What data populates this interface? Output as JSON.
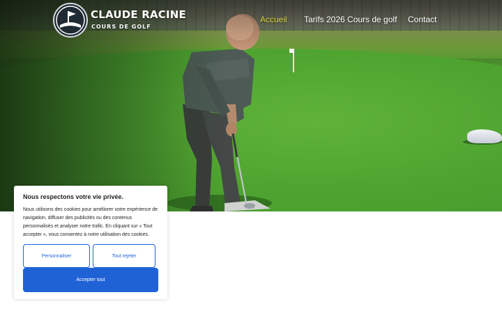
{
  "header": {
    "logo": {
      "name": "CLAUDE RACINE",
      "tagline": "COURS DE GOLF"
    },
    "nav": [
      {
        "label": "Accueil",
        "active": true
      },
      {
        "label": "Tarifs 2026 Cours de golf",
        "active": false
      },
      {
        "label": "Contact",
        "active": false
      }
    ]
  },
  "cookie_banner": {
    "title": "Nous respectons votre vie privée.",
    "text": "Nous utilisons des cookies pour améliorer votre expérience de navigation, diffuser des publicités ou des contenus personnalisés et analyser notre trafic. En cliquant sur « Tout accepter », vous consentez à notre utilisation des cookies.",
    "customize_label": "Personnaliser",
    "reject_label": "Tout rejeter",
    "accept_label": "Accepter tout"
  },
  "colors": {
    "nav_active": "#d6d23a",
    "button_primary": "#1f62d6"
  }
}
